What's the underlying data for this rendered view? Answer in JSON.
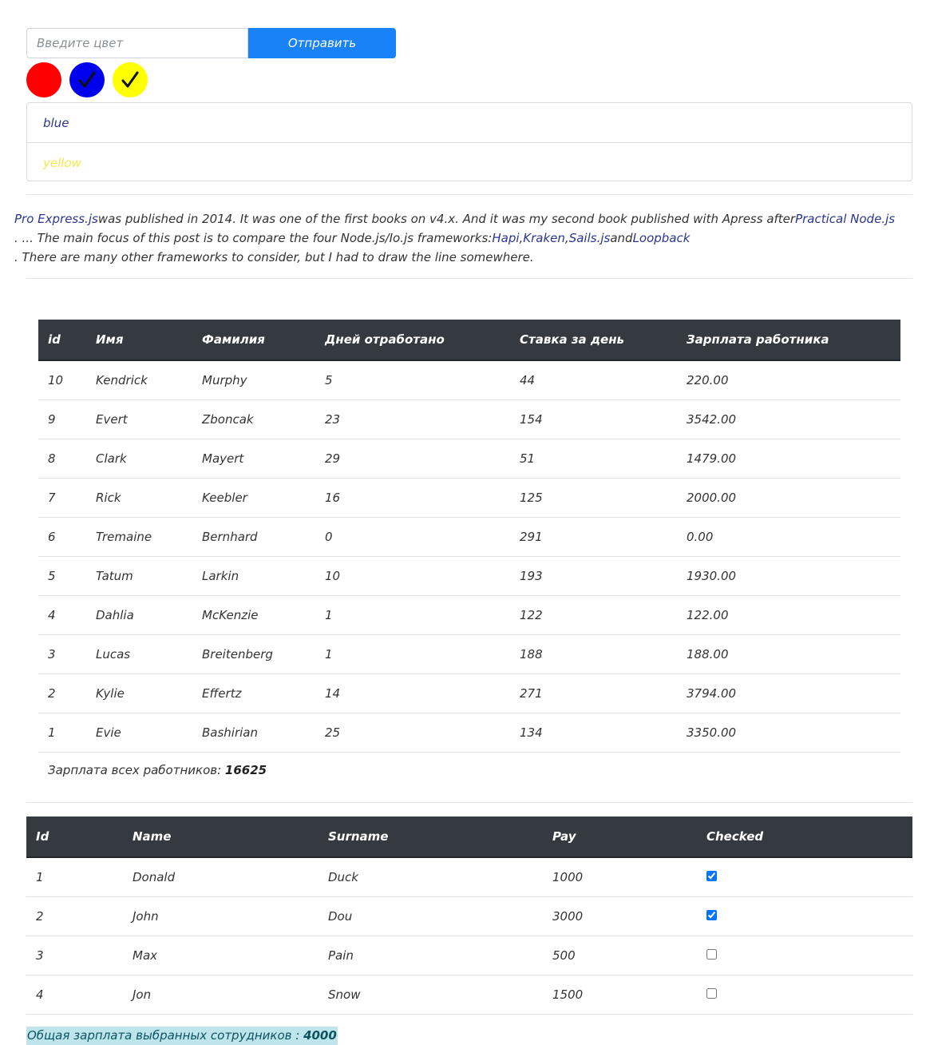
{
  "form": {
    "placeholder": "Введите цвет",
    "submit_label": "Отправить"
  },
  "swatches": [
    {
      "color": "#ff0000",
      "checked": false
    },
    {
      "color": "#0000ee",
      "checked": true
    },
    {
      "color": "#ffff00",
      "checked": true
    }
  ],
  "color_list": [
    {
      "label": "blue",
      "color": "#2a3590"
    },
    {
      "label": "yellow",
      "color": "#f2e94e"
    }
  ],
  "intro": {
    "link1": "Pro Express.js",
    "text1": "was published in 2014. It was one of the first books on v4.x. And it was my second book published with Apress after",
    "link2": "Practical Node.js",
    "text2": ". ... The main focus of this post is to compare the four Node.js/Io.js frameworks:",
    "link3": "Hapi",
    "sep1": ",",
    "link4": "Kraken",
    "sep2": ",",
    "link5": "Sails.js",
    "and": "and",
    "link6": "Loopback",
    "text3": ". There are many other frameworks to consider, but I had to draw the line somewhere."
  },
  "employees": {
    "headers": [
      "id",
      "Имя",
      "Фамилия",
      "Дней отработано",
      "Ставка за день",
      "Зарплата работника"
    ],
    "rows": [
      [
        "10",
        "Kendrick",
        "Murphy",
        "5",
        "44",
        "220.00"
      ],
      [
        "9",
        "Evert",
        "Zboncak",
        "23",
        "154",
        "3542.00"
      ],
      [
        "8",
        "Clark",
        "Mayert",
        "29",
        "51",
        "1479.00"
      ],
      [
        "7",
        "Rick",
        "Keebler",
        "16",
        "125",
        "2000.00"
      ],
      [
        "6",
        "Tremaine",
        "Bernhard",
        "0",
        "291",
        "0.00"
      ],
      [
        "5",
        "Tatum",
        "Larkin",
        "10",
        "193",
        "1930.00"
      ],
      [
        "4",
        "Dahlia",
        "McKenzie",
        "1",
        "122",
        "122.00"
      ],
      [
        "3",
        "Lucas",
        "Breitenberg",
        "1",
        "188",
        "188.00"
      ],
      [
        "2",
        "Kylie",
        "Effertz",
        "14",
        "271",
        "3794.00"
      ],
      [
        "1",
        "Evie",
        "Bashirian",
        "25",
        "134",
        "3350.00"
      ]
    ],
    "total_label": "Зарплата всех работников: ",
    "total_value": "16625"
  },
  "checked_table": {
    "headers": [
      "Id",
      "Name",
      "Surname",
      "Pay",
      "Checked"
    ],
    "rows": [
      {
        "id": "1",
        "name": "Donald",
        "surname": "Duck",
        "pay": "1000",
        "checked": true
      },
      {
        "id": "2",
        "name": "John",
        "surname": "Dou",
        "pay": "3000",
        "checked": true
      },
      {
        "id": "3",
        "name": "Max",
        "surname": "Pain",
        "pay": "500",
        "checked": false
      },
      {
        "id": "4",
        "name": "Jon",
        "surname": "Snow",
        "pay": "1500",
        "checked": false
      }
    ],
    "selected_label": "Общая зарплата выбранных сотрудников : ",
    "selected_value": "4000"
  }
}
